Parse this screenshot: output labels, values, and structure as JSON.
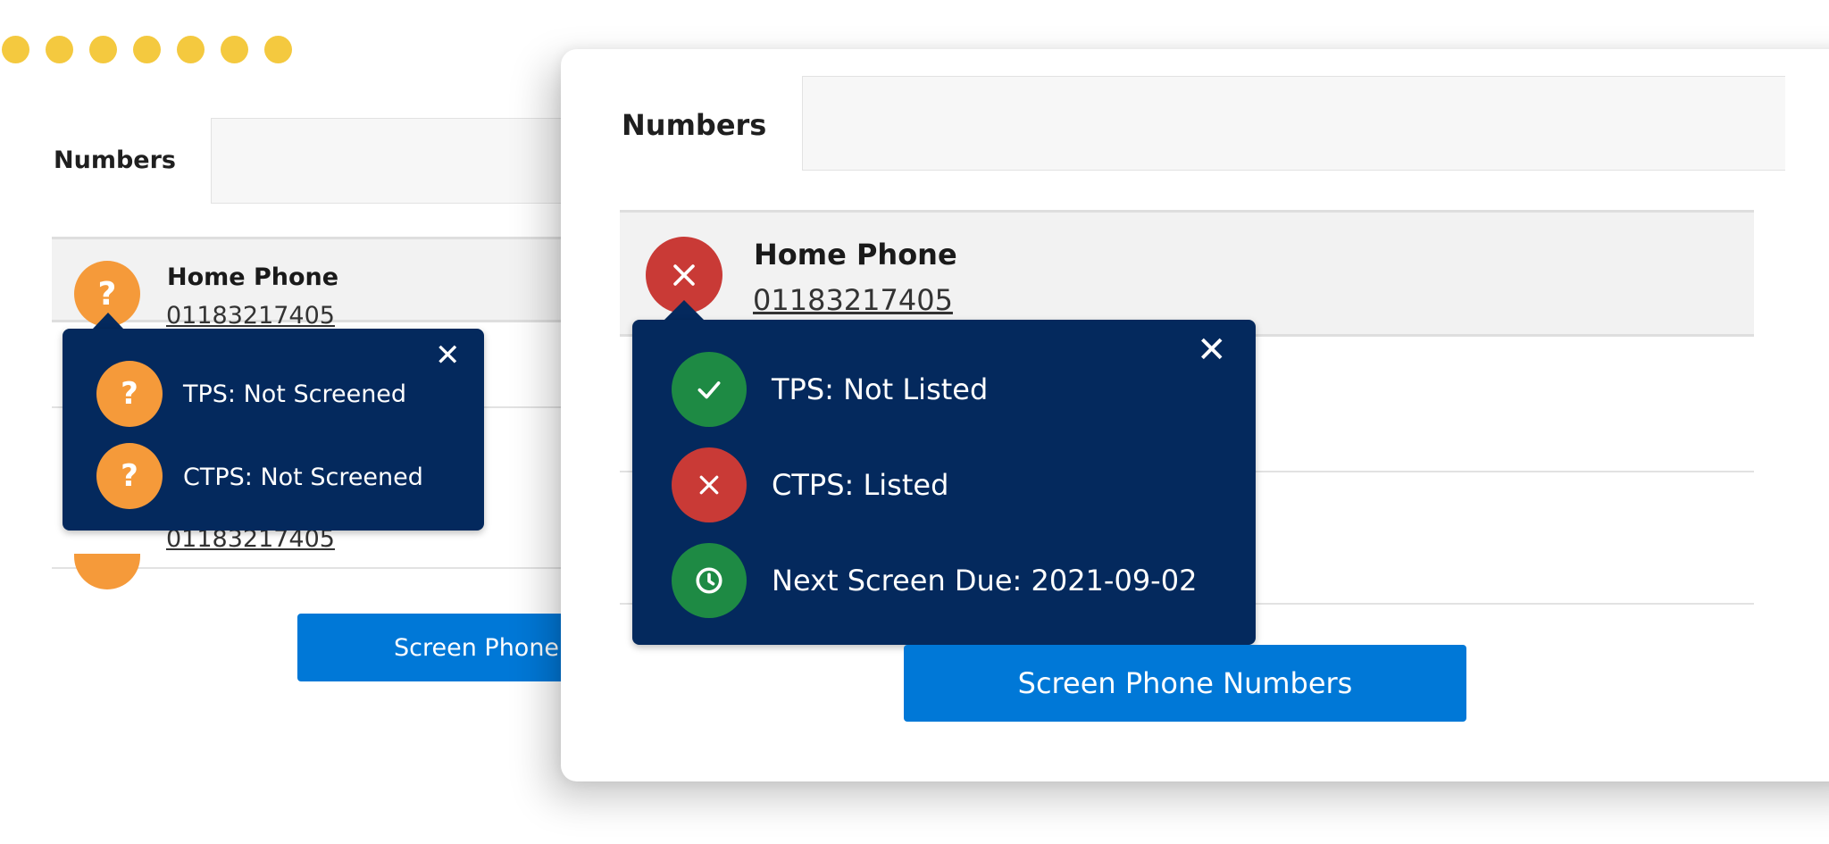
{
  "colors": {
    "accent_dots": "#f4c93f",
    "popup_bg": "#04295d",
    "button_bg": "#0078d7",
    "not_screened": "#f59a3a",
    "listed": "#c93a36",
    "ok": "#1e8a44"
  },
  "back_panel": {
    "numbers_label": "Numbers",
    "rows": [
      {
        "name": "Home Phone",
        "number": "01183217405",
        "status_icon": "question-icon"
      },
      {
        "name": "",
        "number": "01183217405",
        "status_icon": "question-icon"
      }
    ],
    "popup": {
      "close_icon": "close-icon",
      "items": [
        {
          "icon": "question-icon",
          "text": "TPS: Not Screened"
        },
        {
          "icon": "question-icon",
          "text": "CTPS: Not Screened"
        }
      ]
    },
    "button_label": "Screen Phone Numbers"
  },
  "front_panel": {
    "numbers_label": "Numbers",
    "rows": [
      {
        "name": "Home Phone",
        "number": "01183217405",
        "status_icon": "cross-icon"
      }
    ],
    "popup": {
      "close_icon": "close-icon",
      "items": [
        {
          "icon": "check-icon",
          "text": "TPS: Not Listed"
        },
        {
          "icon": "cross-icon",
          "text": "CTPS: Listed"
        },
        {
          "icon": "clock-icon",
          "text": "Next Screen Due: 2021-09-02"
        }
      ]
    },
    "button_label": "Screen Phone Numbers"
  }
}
